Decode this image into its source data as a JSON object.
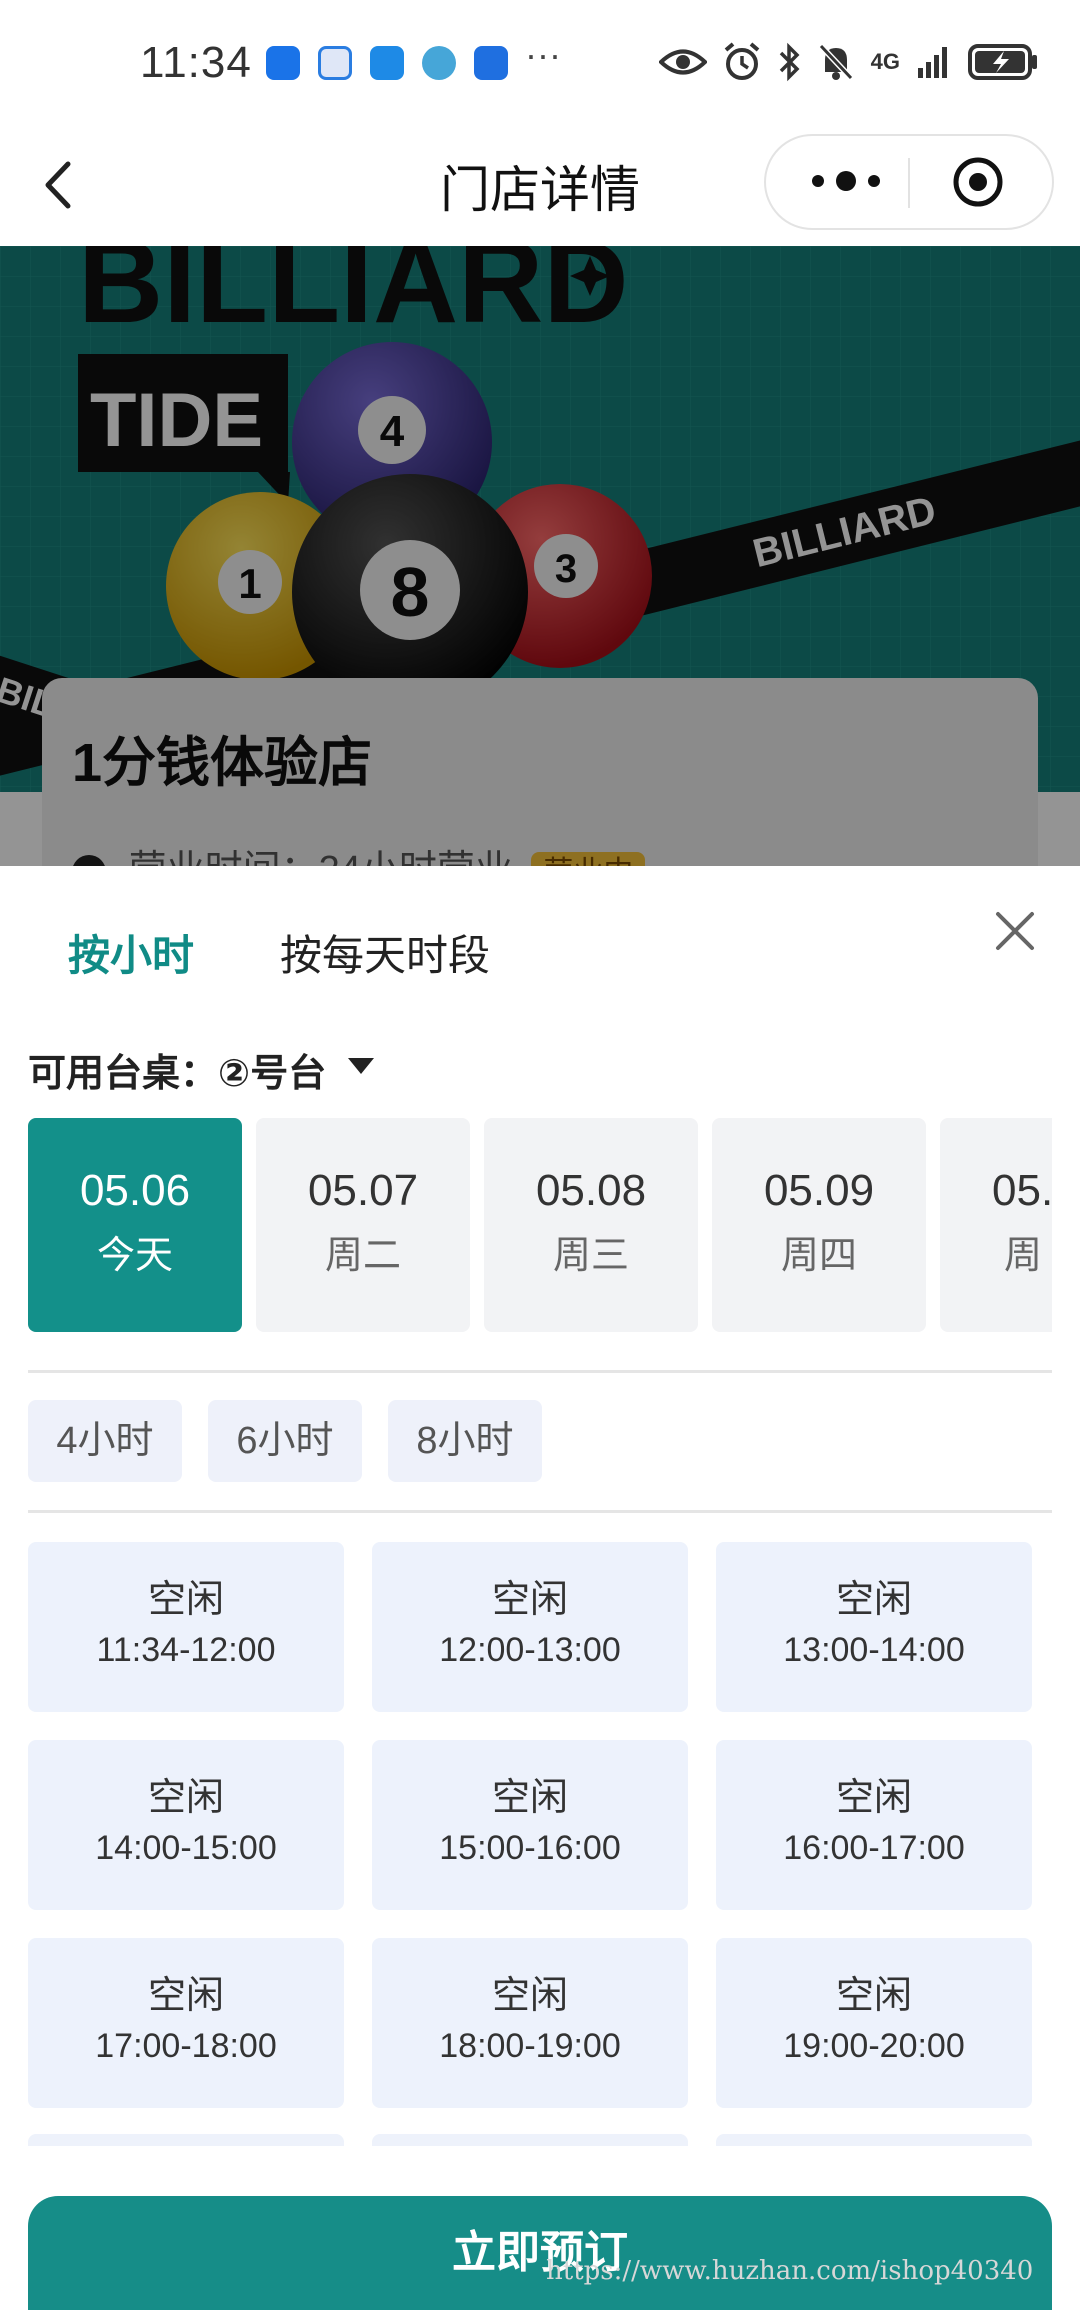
{
  "status_bar": {
    "time": "11:34",
    "network": "4G",
    "app_icon_colors": [
      "#1a73e8",
      "#2a7de1",
      "#1e8ae6",
      "#46a6d8",
      "#1f6fe0"
    ],
    "more": "···"
  },
  "nav": {
    "title": "门店详情"
  },
  "banner": {
    "heading": "BILLIARD",
    "subheading": "TIDE",
    "ribbon_text": "BILLIARD",
    "balls": [
      "4",
      "1",
      "8",
      "3"
    ]
  },
  "store": {
    "name": "1分钱体验店",
    "hours": "营业时间：24小时营业",
    "status_badge": "营业中"
  },
  "sheet": {
    "tabs": [
      "按小时",
      "按每天时段"
    ],
    "table_label": "可用台桌：",
    "table_value": "②号台",
    "dates": [
      {
        "date": "05.06",
        "weekday": "今天"
      },
      {
        "date": "05.07",
        "weekday": "周二"
      },
      {
        "date": "05.08",
        "weekday": "周三"
      },
      {
        "date": "05.09",
        "weekday": "周四"
      },
      {
        "date": "05.",
        "weekday": "周"
      }
    ],
    "durations": [
      "4小时",
      "6小时",
      "8小时"
    ],
    "slots": [
      {
        "status": "空闲",
        "time": "11:34-12:00"
      },
      {
        "status": "空闲",
        "time": "12:00-13:00"
      },
      {
        "status": "空闲",
        "time": "13:00-14:00"
      },
      {
        "status": "空闲",
        "time": "14:00-15:00"
      },
      {
        "status": "空闲",
        "time": "15:00-16:00"
      },
      {
        "status": "空闲",
        "time": "16:00-17:00"
      },
      {
        "status": "空闲",
        "time": "17:00-18:00"
      },
      {
        "status": "空闲",
        "time": "18:00-19:00"
      },
      {
        "status": "空闲",
        "time": "19:00-20:00"
      }
    ],
    "book_button": "立即预订"
  },
  "watermark": "https://www.huzhan.com/ishop40340",
  "colors": {
    "accent": "#13908a",
    "slot_bg": "#edf2fc",
    "banner_bg": "#15807a"
  }
}
